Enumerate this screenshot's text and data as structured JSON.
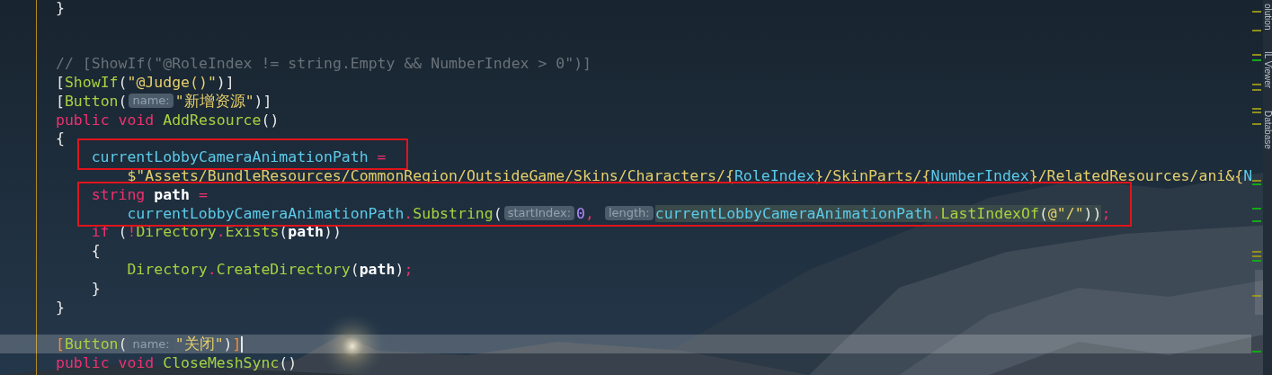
{
  "editor": {
    "lines": [
      {
        "kind": "code",
        "current": false,
        "tokens": [
          {
            "text": "}",
            "kind": "plain"
          }
        ]
      },
      {
        "kind": "blank"
      },
      {
        "kind": "blank"
      },
      {
        "kind": "code",
        "current": false,
        "tokens": [
          {
            "text": "// [ShowIf(\"@RoleIndex != string.Empty && NumberIndex > 0\")]",
            "kind": "comment"
          }
        ]
      },
      {
        "kind": "code",
        "current": false,
        "tokens": [
          {
            "text": "[",
            "kind": "plain"
          },
          {
            "text": "ShowIf",
            "kind": "fn"
          },
          {
            "text": "(",
            "kind": "plain"
          },
          {
            "text": "\"@Judge()\"",
            "kind": "str"
          },
          {
            "text": ")]",
            "kind": "plain"
          }
        ]
      },
      {
        "kind": "code",
        "current": false,
        "tokens": [
          {
            "text": "[",
            "kind": "plain"
          },
          {
            "text": "Button",
            "kind": "fn"
          },
          {
            "text": "(",
            "kind": "plain"
          },
          {
            "text": "name:",
            "kind": "hint"
          },
          {
            "text": "\"新增资源\"",
            "kind": "str"
          },
          {
            "text": ")]",
            "kind": "plain"
          }
        ]
      },
      {
        "kind": "code",
        "current": false,
        "tokens": [
          {
            "text": "public void ",
            "kind": "kw"
          },
          {
            "text": "AddResource",
            "kind": "fn"
          },
          {
            "text": "()",
            "kind": "plain"
          }
        ]
      },
      {
        "kind": "code",
        "current": false,
        "tokens": [
          {
            "text": "{",
            "kind": "plain"
          }
        ],
        "children": [
          {
            "kind": "boxed",
            "lines": [
              {
                "kind": "code",
                "current": false,
                "tokens": [
                  {
                    "text": "currentLobbyCameraAnimationPath",
                    "kind": "field"
                  },
                  {
                    "text": " =",
                    "kind": "punct"
                  }
                ]
              }
            ],
            "children": [
              {
                "kind": "code",
                "current": false,
                "tokens": [
                  {
                    "text": "$\"Assets/BundleResources/CommonRegion/OutsideGame/Skins/Characters/{",
                    "kind": "str"
                  },
                  {
                    "text": "RoleIndex",
                    "kind": "field"
                  },
                  {
                    "text": "}/SkinParts/{",
                    "kind": "str"
                  },
                  {
                    "text": "NumberIndex",
                    "kind": "field"
                  },
                  {
                    "text": "}/RelatedResources/ani&{",
                    "kind": "str"
                  },
                  {
                    "text": "N",
                    "kind": "field"
                  }
                ]
              }
            ]
          },
          {
            "kind": "boxed",
            "lines": [
              {
                "kind": "code",
                "current": false,
                "tokens": [
                  {
                    "text": "string ",
                    "kind": "kw"
                  },
                  {
                    "text": "path",
                    "kind": "var"
                  },
                  {
                    "text": " =",
                    "kind": "punct"
                  }
                ],
                "children": [
                  {
                    "kind": "code",
                    "current": false,
                    "tokens": [
                      {
                        "text": "currentLobbyCameraAnimationPath",
                        "kind": "field"
                      },
                      {
                        "text": ".",
                        "kind": "punct"
                      },
                      {
                        "text": "Substring",
                        "kind": "fn"
                      },
                      {
                        "text": "(",
                        "kind": "plain"
                      },
                      {
                        "text": "startIndex:",
                        "kind": "hint"
                      },
                      {
                        "text": "0",
                        "kind": "num"
                      },
                      {
                        "text": ", ",
                        "kind": "punct"
                      },
                      {
                        "text": "length:",
                        "kind": "hint"
                      },
                      {
                        "text": "currentLobbyCameraAnimationPath",
                        "kind": "field",
                        "highlighted": true
                      },
                      {
                        "text": ".",
                        "kind": "punct",
                        "highlighted": true
                      },
                      {
                        "text": "LastIndexOf",
                        "kind": "fn",
                        "highlighted": true
                      },
                      {
                        "text": "(",
                        "kind": "plain",
                        "highlighted": true
                      },
                      {
                        "text": "@\"/\"",
                        "kind": "str",
                        "highlighted": true
                      },
                      {
                        "text": "))",
                        "kind": "plain",
                        "highlighted": true
                      },
                      {
                        "text": ";",
                        "kind": "punct"
                      }
                    ]
                  }
                ]
              }
            ]
          },
          {
            "kind": "code",
            "current": false,
            "tokens": [
              {
                "text": "if ",
                "kind": "kw"
              },
              {
                "text": "(",
                "kind": "plain"
              },
              {
                "text": "!",
                "kind": "punct"
              },
              {
                "text": "Directory",
                "kind": "fn"
              },
              {
                "text": ".",
                "kind": "punct"
              },
              {
                "text": "Exists",
                "kind": "fn"
              },
              {
                "text": "(",
                "kind": "plain"
              },
              {
                "text": "path",
                "kind": "var"
              },
              {
                "text": "))",
                "kind": "plain"
              }
            ]
          },
          {
            "kind": "code",
            "current": false,
            "tokens": [
              {
                "text": "{",
                "kind": "plain"
              }
            ],
            "children": [
              {
                "kind": "code",
                "current": false,
                "tokens": [
                  {
                    "text": "Directory",
                    "kind": "fn"
                  },
                  {
                    "text": ".",
                    "kind": "punct"
                  },
                  {
                    "text": "CreateDirectory",
                    "kind": "fn"
                  },
                  {
                    "text": "(",
                    "kind": "plain"
                  },
                  {
                    "text": "path",
                    "kind": "var"
                  },
                  {
                    "text": ")",
                    "kind": "plain"
                  },
                  {
                    "text": ";",
                    "kind": "punct"
                  }
                ]
              }
            ]
          },
          {
            "kind": "code",
            "current": false,
            "tokens": [
              {
                "text": "}",
                "kind": "plain"
              }
            ]
          }
        ]
      },
      {
        "kind": "code",
        "current": false,
        "tokens": [
          {
            "text": "}",
            "kind": "plain"
          }
        ]
      },
      {
        "kind": "blank"
      },
      {
        "kind": "code",
        "current": true,
        "tokens": [
          {
            "text": "[",
            "kind": "match"
          },
          {
            "text": "Button",
            "kind": "fn"
          },
          {
            "text": "(",
            "kind": "plain"
          },
          {
            "text": "name:",
            "kind": "hint"
          },
          {
            "text": "\"关闭\"",
            "kind": "str"
          },
          {
            "text": ")",
            "kind": "plain"
          },
          {
            "text": "]",
            "kind": "match"
          }
        ]
      },
      {
        "kind": "code",
        "current": false,
        "tokens": [
          {
            "text": "public void ",
            "kind": "kw"
          },
          {
            "text": "CloseMeshSync",
            "kind": "fn"
          },
          {
            "text": "()",
            "kind": "plain"
          }
        ]
      }
    ]
  },
  "tool_tabs": [
    "olution",
    "IL Viewer",
    "Database"
  ]
}
